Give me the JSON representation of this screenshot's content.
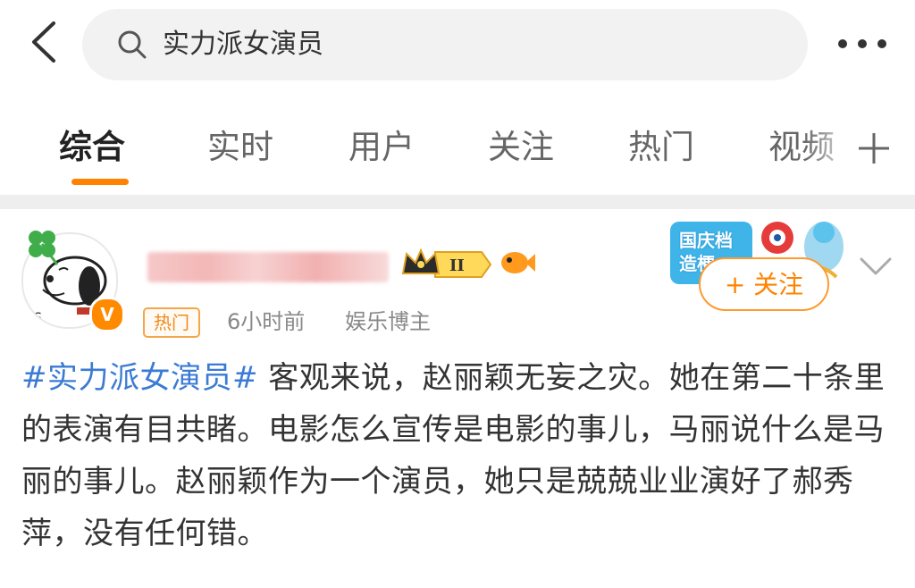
{
  "search": {
    "query": "实力派女演员",
    "back_icon": "chevron-left-icon",
    "search_icon": "magnifier-icon",
    "more_icon": "more-dots-icon"
  },
  "tabs": [
    {
      "label": "综合",
      "active": true
    },
    {
      "label": "实时",
      "active": false
    },
    {
      "label": "用户",
      "active": false
    },
    {
      "label": "关注",
      "active": false
    },
    {
      "label": "热门",
      "active": false
    },
    {
      "label": "视频",
      "active": false
    }
  ],
  "tabs_add_icon": "plus-icon",
  "accent_color": "#ff8200",
  "link_color": "#3b7bd4",
  "post": {
    "badge_level": "II",
    "hot_tag": "热门",
    "time": "6小时前",
    "role": "娱乐博主",
    "promo_text": "国庆档\n造梗",
    "follow_label": "+ 关注",
    "hashtag": "#实力派女演员#",
    "body": " 客观来说，赵丽颖无妄之灾。她在第二十条里的表演有目共睹。电影怎么宣传是电影的事儿，马丽说什么是马丽的事儿。赵丽颖作为一个演员，她只是兢兢业业演好了郝秀萍，没有任何错。"
  }
}
